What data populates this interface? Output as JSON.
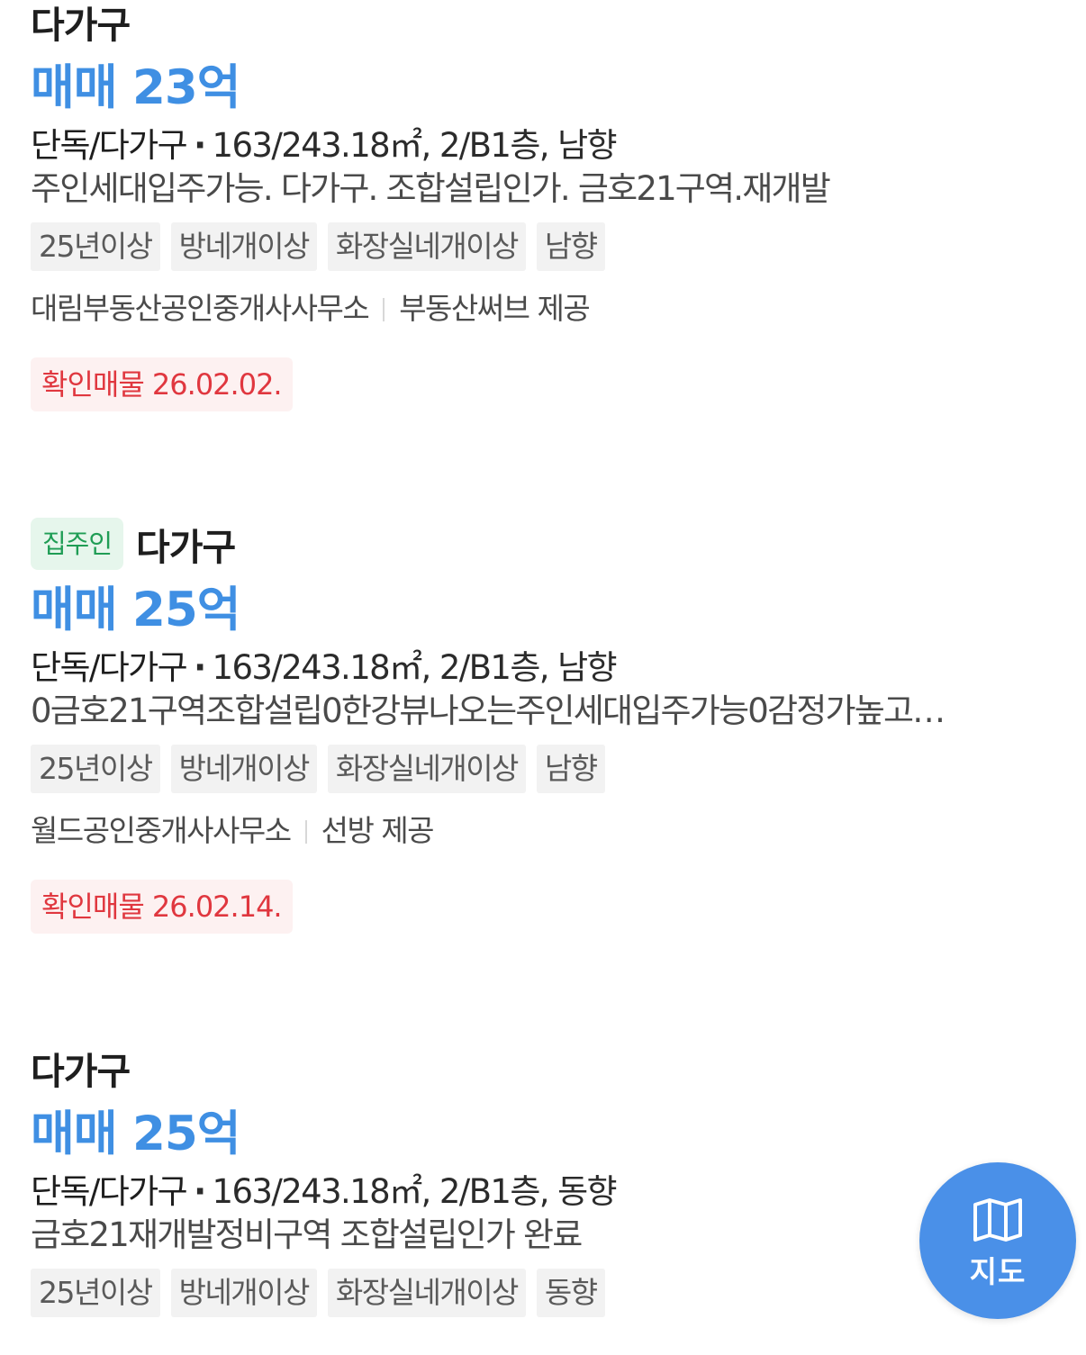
{
  "listings": [
    {
      "owner_badge": "",
      "title": "다가구",
      "price": "매매 23억",
      "property_type": "단독/다가구",
      "spec": "163/243.18㎡, 2/B1층, 남향",
      "description": "주인세대입주가능. 다가구. 조합설립인가. 금호21구역.재개발",
      "tags": [
        "25년이상",
        "방네개이상",
        "화장실네개이상",
        "남향"
      ],
      "agency": "대림부동산공인중개사사무소",
      "provider": "부동산써브 제공",
      "verified": "확인매물 26.02.02."
    },
    {
      "owner_badge": "집주인",
      "title": "다가구",
      "price": "매매 25억",
      "property_type": "단독/다가구",
      "spec": "163/243.18㎡, 2/B1층, 남향",
      "description": "0금호21구역조합설립0한강뷰나오는주인세대입주가능0감정가높고…",
      "tags": [
        "25년이상",
        "방네개이상",
        "화장실네개이상",
        "남향"
      ],
      "agency": "월드공인중개사사무소",
      "provider": "선방 제공",
      "verified": "확인매물 26.02.14."
    },
    {
      "owner_badge": "",
      "title": "다가구",
      "price": "매매 25억",
      "property_type": "단독/다가구",
      "spec": "163/243.18㎡, 2/B1층, 동향",
      "description": "금호21재개발정비구역 조합설립인가 완료",
      "tags": [
        "25년이상",
        "방네개이상",
        "화장실네개이상",
        "동향"
      ]
    }
  ],
  "map_button": {
    "label": "지도",
    "icon": "map-icon"
  },
  "colors": {
    "price": "#3f8fe3",
    "verified_text": "#e0373f",
    "verified_bg": "#fdf1f1",
    "owner_badge_text": "#1f9d55",
    "owner_badge_bg": "#e6f6ec",
    "map_button_bg": "#4a90e8"
  }
}
